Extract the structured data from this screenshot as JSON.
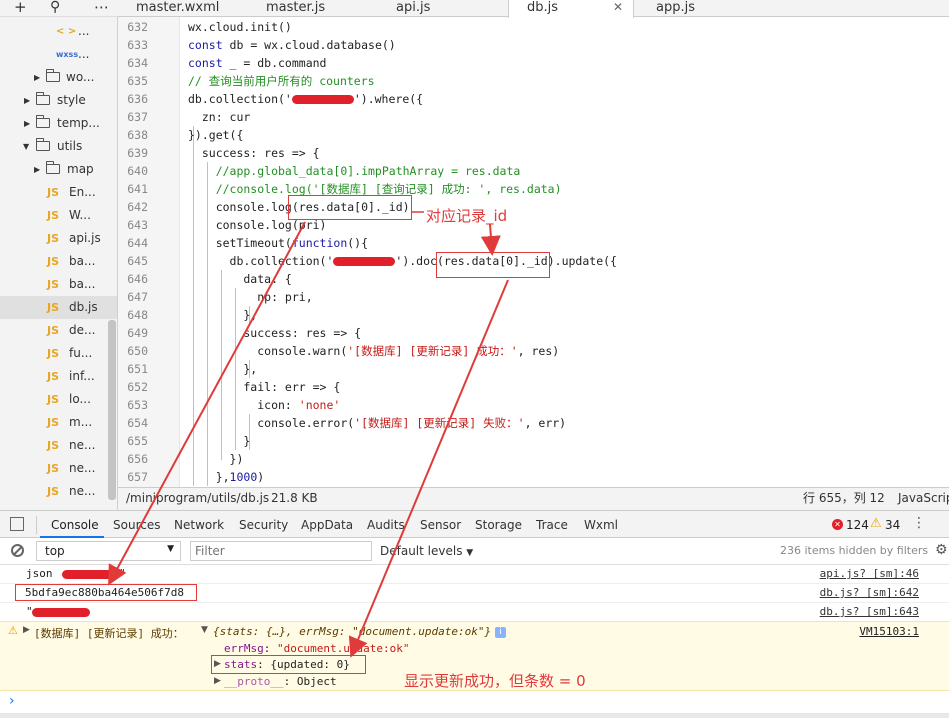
{
  "sidebar": {
    "toolbar": {
      "add": "+",
      "search": "⚲",
      "more": "⋯"
    },
    "items": [
      {
        "label": "...",
        "type": "file-wxml-tag",
        "icon": "< >"
      },
      {
        "label": "...",
        "type": "file-wxss",
        "icon": "wxss"
      },
      {
        "label": "wo...",
        "type": "folder-collapsed"
      },
      {
        "label": "style",
        "type": "folder-collapsed"
      },
      {
        "label": "temp...",
        "type": "folder-collapsed"
      },
      {
        "label": "utils",
        "type": "folder-expanded"
      },
      {
        "label": "map",
        "type": "folder-collapsed"
      },
      {
        "label": "En...",
        "type": "js"
      },
      {
        "label": "W...",
        "type": "js"
      },
      {
        "label": "api.js",
        "type": "js"
      },
      {
        "label": "ba...",
        "type": "js"
      },
      {
        "label": "ba...",
        "type": "js"
      },
      {
        "label": "db.js",
        "type": "js",
        "selected": true
      },
      {
        "label": "de...",
        "type": "js"
      },
      {
        "label": "fu...",
        "type": "js"
      },
      {
        "label": "inf...",
        "type": "js"
      },
      {
        "label": "lo...",
        "type": "js"
      },
      {
        "label": "m...",
        "type": "js"
      },
      {
        "label": "ne...",
        "type": "js"
      },
      {
        "label": "ne...",
        "type": "js"
      },
      {
        "label": "ne...",
        "type": "js"
      }
    ]
  },
  "tabs": [
    {
      "label": "master.wxml"
    },
    {
      "label": "master.js"
    },
    {
      "label": "api.js"
    },
    {
      "label": "db.js",
      "active": true,
      "close": "✕"
    },
    {
      "label": "app.js"
    }
  ],
  "editor": {
    "lines": [
      {
        "n": "632"
      },
      {
        "n": "633"
      },
      {
        "n": "634"
      },
      {
        "n": "635"
      },
      {
        "n": "636"
      },
      {
        "n": "637"
      },
      {
        "n": "638"
      },
      {
        "n": "639"
      },
      {
        "n": "640"
      },
      {
        "n": "641"
      },
      {
        "n": "642"
      },
      {
        "n": "643"
      },
      {
        "n": "644"
      },
      {
        "n": "645"
      },
      {
        "n": "646"
      },
      {
        "n": "647"
      },
      {
        "n": "648"
      },
      {
        "n": "649"
      },
      {
        "n": "650"
      },
      {
        "n": "651"
      },
      {
        "n": "652"
      },
      {
        "n": "653"
      },
      {
        "n": "654"
      },
      {
        "n": "655"
      },
      {
        "n": "656"
      },
      {
        "n": "657"
      }
    ],
    "code": {
      "l632": "wx.cloud.init()",
      "l633a": "const",
      "l633b": " db = wx.cloud.database()",
      "l634a": "const",
      "l634b": " _ = db.command",
      "l635": "// 查询当前用户所有的 counters",
      "l636a": "db.collection('",
      "l636b": "').where({",
      "l637": "  zn: cur",
      "l638": "}).get({",
      "l639": "  success: res => {",
      "l640": "    //app.global_data[0].impPathArray = res.data",
      "l641": "    //console.log('[数据库] [查询记录] 成功: ', res.data)",
      "l642a": "    console.log(",
      "l642b": "res.data[0]._id)",
      "l643": "    console.log(pri)",
      "l644a": "    setTimeout(",
      "l644b": "function",
      "l644c": "(){",
      "l645a": "      db.collection('",
      "l645b": "').doc(",
      "l645c": "res.data[0]._id",
      "l645d": ").update({",
      "l646": "        data: {",
      "l647": "          np: pri,",
      "l648": "        },",
      "l649": "        success: res => {",
      "l650a": "          console.warn(",
      "l650b": "'[数据库] [更新记录] 成功：'",
      "l650c": ", res)",
      "l651": "        },",
      "l652": "        fail: err => {",
      "l653a": "          icon: ",
      "l653b": "'none'",
      "l654a": "          console.error(",
      "l654b": "'[数据库] [更新记录] 失败：'",
      "l654c": ", err)",
      "l655": "        }",
      "l656": "      })",
      "l657a": "    },",
      "l657b": "1000",
      "l657c": ")"
    }
  },
  "statusbar": {
    "path": "/miniprogram/utils/db.js",
    "size": "21.8 KB",
    "position": "行 655，列 12",
    "language": "JavaScript"
  },
  "devtools": {
    "tabs": [
      "Console",
      "Sources",
      "Network",
      "Security",
      "AppData",
      "Audits",
      "Sensor",
      "Storage",
      "Trace",
      "Wxml"
    ],
    "errors": "124",
    "warnings": "34",
    "context": "top",
    "filter_placeholder": "Filter",
    "levels": "Default levels",
    "hidden": "236 items hidden by filters"
  },
  "console": {
    "row1_text": "json",
    "row1_tail": "\"",
    "row1_src": "api.js? [sm]:46",
    "row2_text": "5bdfa9ec880ba464e506f7d8",
    "row2_src": "db.js? [sm]:642",
    "row3_text": "\"",
    "row3_src": "db.js? [sm]:643",
    "warn_prefix": "[数据库] [更新记录] 成功：",
    "warn_obj": "{stats: {…}, errMsg: \"document.update:ok\"}",
    "warn_info": "i",
    "warn_src": "VM15103:1",
    "errmsg_key": "errMsg",
    "errmsg_val": "\"document.update:ok\"",
    "stats_key": "stats",
    "stats_val": "{updated: 0}",
    "proto_key": "__proto__",
    "proto_val": "Object",
    "prompt": "›"
  },
  "annotations": {
    "record_id": "对应记录_id",
    "update_result": "显示更新成功，但条数 = 0"
  },
  "colors": {
    "annotation": "#e03a3a",
    "js_icon": "#e8a623",
    "keyword": "#1a1aa6",
    "comment": "#239023",
    "string": "#c41a16",
    "accent": "#1a73e8"
  }
}
